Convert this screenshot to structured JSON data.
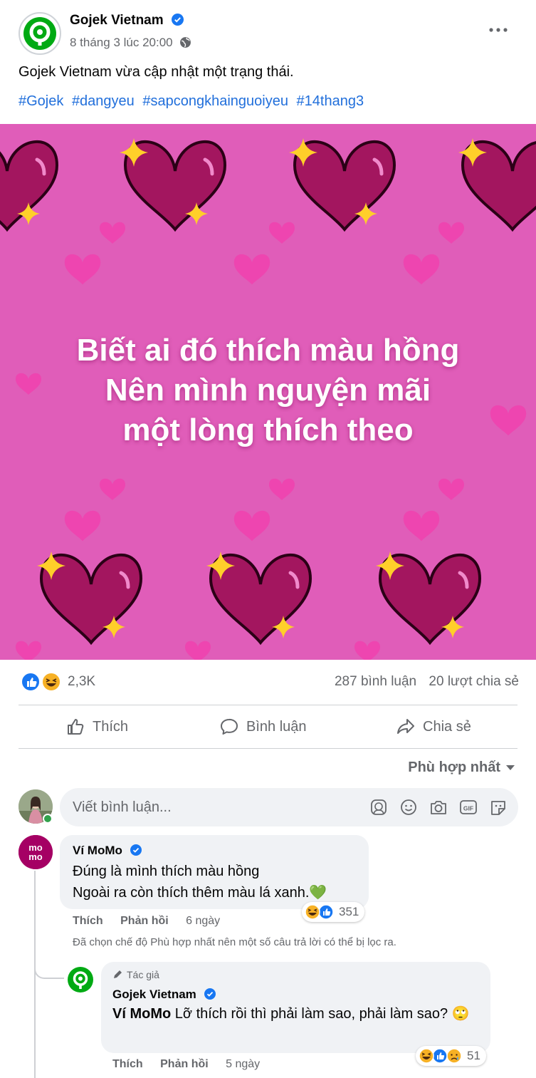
{
  "post": {
    "page_name": "Gojek Vietnam",
    "timestamp": "8 tháng 3 lúc 20:00",
    "status": "Gojek Vietnam vừa cập nhật một trạng thái.",
    "hashtags": [
      "#Gojek",
      "#dangyeu",
      "#sapcongkhainguoiyeu",
      "#14thang3"
    ],
    "image_text": [
      "Biết ai đó thích màu hồng",
      "Nên mình nguyện mãi",
      "một lòng thích theo"
    ]
  },
  "stats": {
    "reactions": "2,3K",
    "comments": "287 bình luận",
    "shares": "20 lượt chia sẻ"
  },
  "actions": {
    "like": "Thích",
    "comment": "Bình luận",
    "share": "Chia sẻ"
  },
  "sort": {
    "label": "Phù hợp nhất"
  },
  "composer": {
    "placeholder": "Viết bình luận..."
  },
  "comments": [
    {
      "author": "Ví MoMo",
      "avatar_text": "mo mo",
      "lines": [
        "Đúng là mình thích màu hồng",
        "Ngoài ra còn thích thêm màu lá xanh.💚"
      ],
      "like": "Thích",
      "reply": "Phản hồi",
      "time": "6 ngày",
      "reaction_count": "351"
    }
  ],
  "filter_note": "Đã chọn chế độ Phù hợp nhất nên một số câu trả lời có thể bị lọc ra.",
  "reply": {
    "author_tag": "Tác giả",
    "author": "Gojek Vietnam",
    "mention": "Ví MoMo",
    "text": " Lỡ thích rồi thì phải làm sao, phải làm sao? 🙄",
    "like": "Thích",
    "reply": "Phản hồi",
    "time": "5 ngày",
    "reaction_count": "51"
  },
  "colors": {
    "gojek_green": "#00aa13",
    "link_blue": "#216fdb",
    "image_pink": "#e05db9",
    "heart_dark": "#a3165f",
    "momo_purple": "#a50064"
  }
}
